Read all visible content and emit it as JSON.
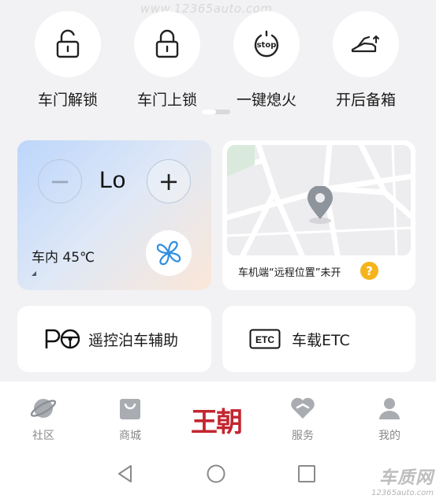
{
  "watermark": {
    "top_text": "www.12365auto.com",
    "brand_text": "车质网",
    "brand_url": "12365auto.com"
  },
  "quick_actions": [
    {
      "label": "车门解锁",
      "icon": "unlock-icon"
    },
    {
      "label": "车门上锁",
      "icon": "lock-icon"
    },
    {
      "label": "一键熄火",
      "icon": "stop-engine-icon",
      "icon_text": "stop"
    },
    {
      "label": "开后备箱",
      "icon": "trunk-open-icon"
    }
  ],
  "climate": {
    "minus": "−",
    "plus": "+",
    "temperature_setting": "Lo",
    "inside_temp": "车内 45℃"
  },
  "map_card": {
    "status_text": "车机端“远程位置”未开",
    "help": "?"
  },
  "features": {
    "remote_parking": {
      "label": "遥控泊车辅助",
      "icon_text": "P"
    },
    "etc": {
      "label": "车载ETC",
      "icon_text": "ETC"
    }
  },
  "bottom_nav": {
    "tabs": [
      {
        "label": "社区",
        "icon": "planet-icon"
      },
      {
        "label": "商城",
        "icon": "shopping-bag-icon"
      },
      {
        "label": "服务",
        "icon": "service-heart-icon"
      },
      {
        "label": "我的",
        "icon": "profile-icon"
      }
    ],
    "brand": "王朝"
  },
  "colors": {
    "accent": "#2f8fe0",
    "brand_red": "#c3262f",
    "help_yellow": "#f6b41c"
  }
}
